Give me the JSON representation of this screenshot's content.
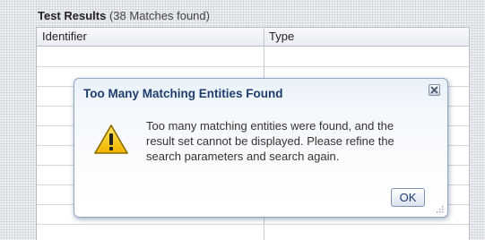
{
  "panel": {
    "title": "Test Results",
    "count_text": "(38 Matches found)"
  },
  "table": {
    "columns": [
      "Identifier",
      "Type"
    ],
    "rows": 9
  },
  "dialog": {
    "title": "Too Many Matching Entities Found",
    "message_lines": [
      "Too many matching entities were found, and the",
      "result set cannot be displayed. Please refine the",
      "search parameters and search again."
    ],
    "ok_label": "OK",
    "icon": "warning-icon",
    "close_icon": "close-icon"
  },
  "colors": {
    "dialog_title": "#1d3d6e",
    "warning_fill": "#f5c400",
    "dialog_border": "#8fa6c4"
  }
}
